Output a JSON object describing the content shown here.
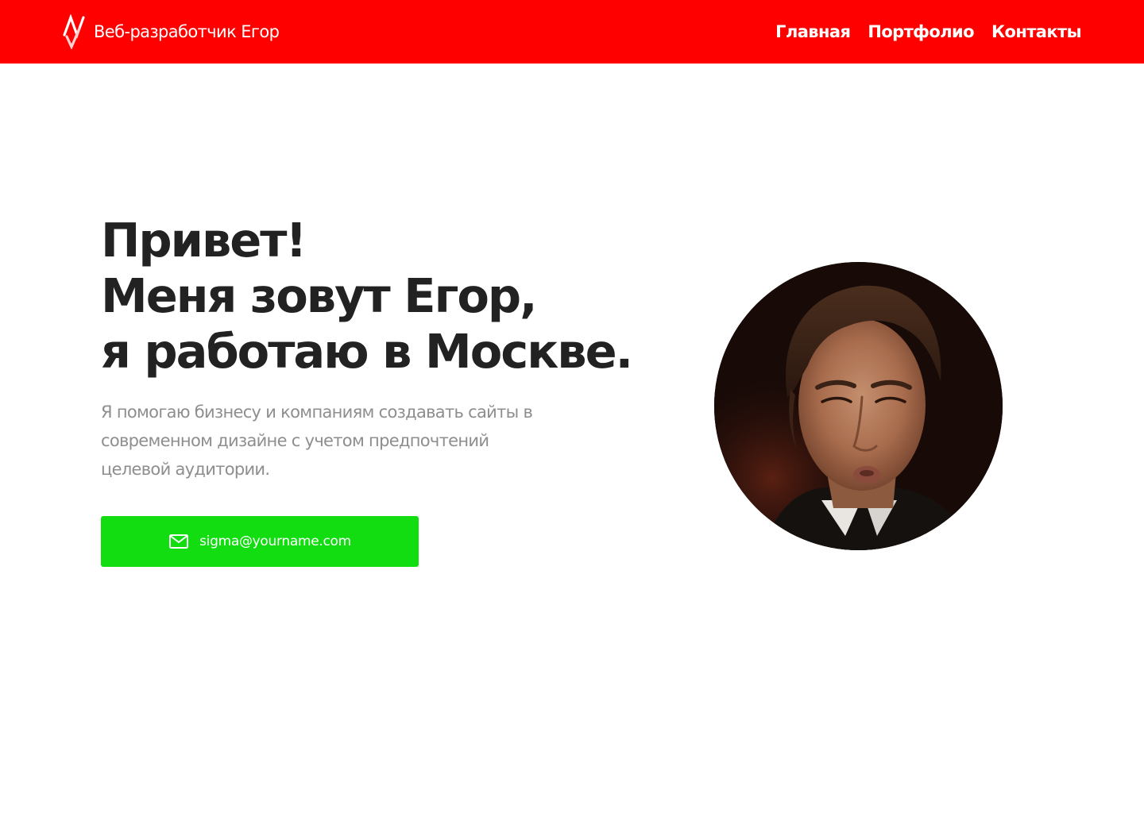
{
  "header": {
    "brand": {
      "logo_icon": "pulse-logo-icon",
      "name": "Веб-разработчик Егор"
    },
    "nav": [
      {
        "label": "Главная"
      },
      {
        "label": "Портфолио"
      },
      {
        "label": "Контакты"
      }
    ]
  },
  "hero": {
    "title_lines": [
      "Привет!",
      "Меня зовут Егор,",
      "я работаю в Москве."
    ],
    "description_lines": [
      "Я помогаю бизнесу и компаниям создавать сайты в",
      "современном дизайне с учетом предпочтений",
      "целевой аудитории."
    ],
    "email_button": {
      "icon": "mail-icon",
      "label": "sigma@yourname.com"
    }
  },
  "portrait": {
    "subject": "portrait-photo"
  },
  "colors": {
    "header_bg": "#ff0000",
    "button_bg": "#11dd11",
    "title_text": "#222222",
    "body_text": "#8e8e8e",
    "page_bg": "#ffffff"
  }
}
